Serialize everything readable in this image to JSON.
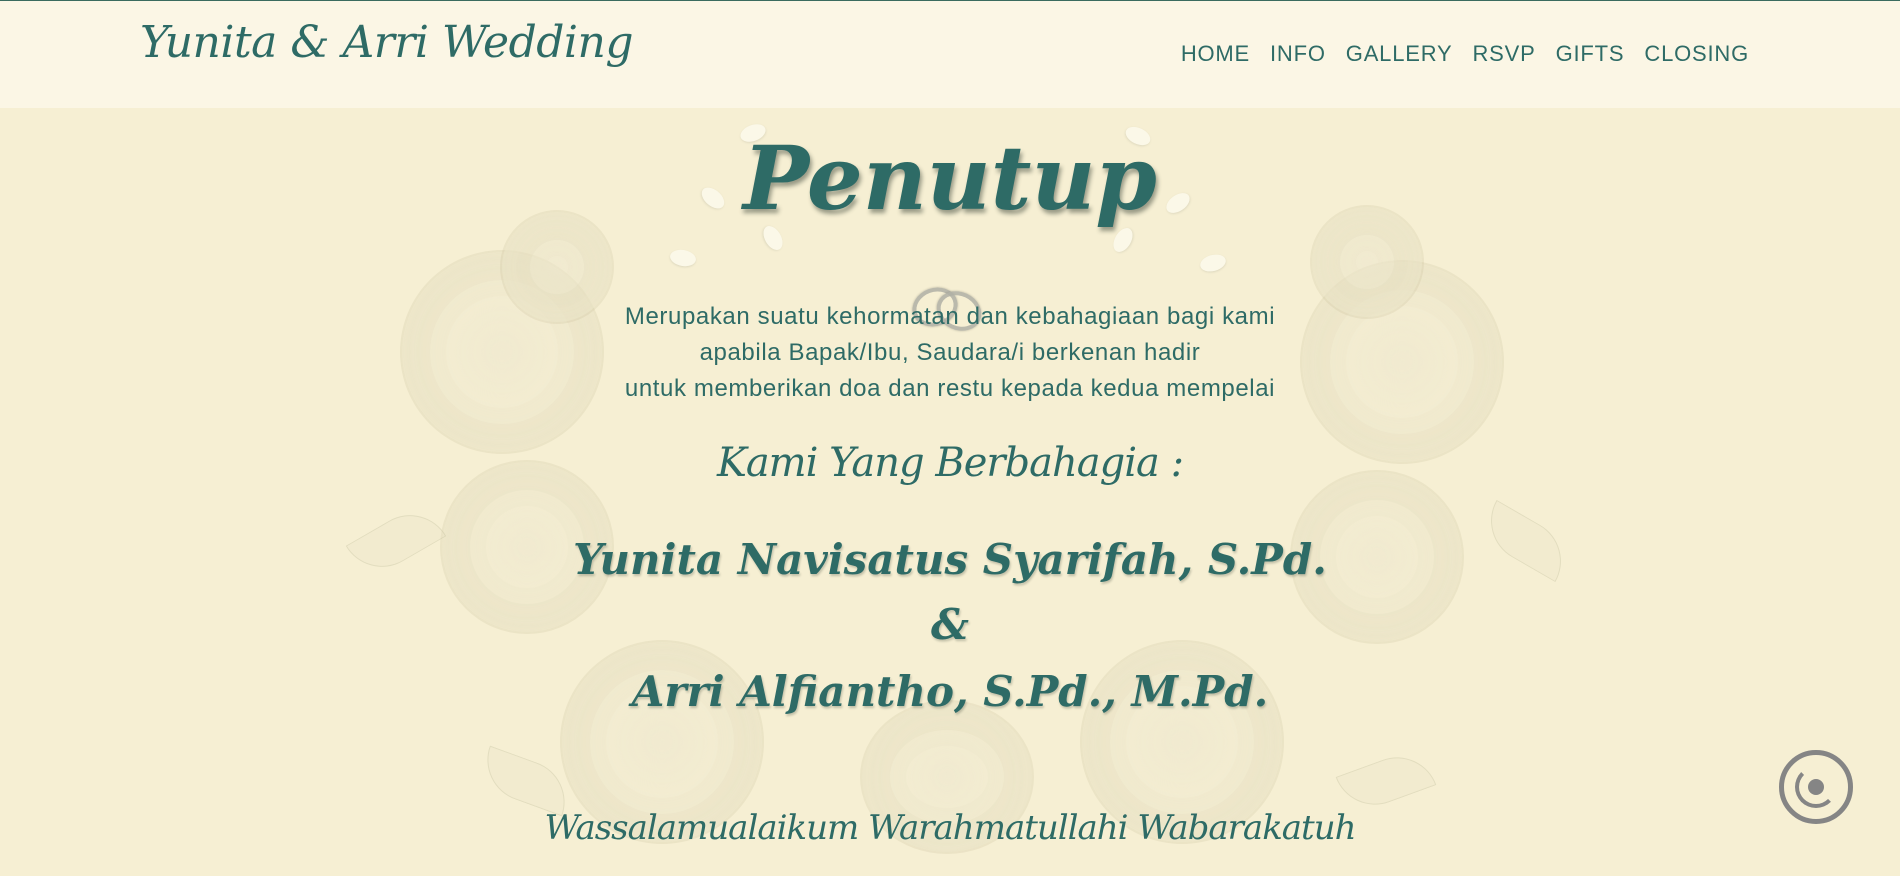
{
  "header": {
    "brand": "Yunita & Arri Wedding",
    "nav": [
      {
        "label": "HOME"
      },
      {
        "label": "INFO"
      },
      {
        "label": "GALLERY"
      },
      {
        "label": "RSVP"
      },
      {
        "label": "GIFTS"
      },
      {
        "label": "CLOSING"
      }
    ]
  },
  "main": {
    "title": "Penutup",
    "paragraph": [
      "Merupakan suatu kehormatan dan kebahagiaan bagi kami",
      "apabila Bapak/Ibu, Saudara/i berkenan hadir",
      "untuk memberikan doa dan restu kepada kedua mempelai"
    ],
    "subtitle": "Kami Yang Berbahagia :",
    "bride": "Yunita Navisatus Syarifah, S.Pd.",
    "ampersand": "&",
    "groom": "Arri Alfiantho, S.Pd., M.Pd.",
    "closing": "Wassalamualaikum Warahmatullahi Wabarakatuh"
  },
  "music_button": {
    "icon": "music-disc-icon"
  },
  "colors": {
    "background": "#f6efd3",
    "header": "#fbf7e7",
    "text": "#2e6b66",
    "button": "#858585"
  }
}
